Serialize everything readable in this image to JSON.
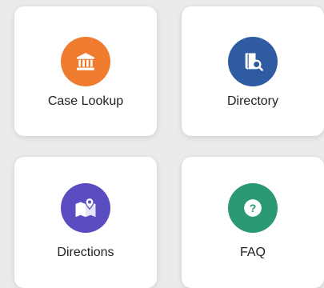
{
  "cards": [
    {
      "label": "Case Lookup",
      "icon": "courthouse-icon",
      "color": "#ef7b2f"
    },
    {
      "label": "Directory",
      "icon": "book-search-icon",
      "color": "#2f5ba3"
    },
    {
      "label": "Directions",
      "icon": "map-pin-icon",
      "color": "#5a4cc1"
    },
    {
      "label": "FAQ",
      "icon": "question-icon",
      "color": "#2b9a74"
    }
  ]
}
